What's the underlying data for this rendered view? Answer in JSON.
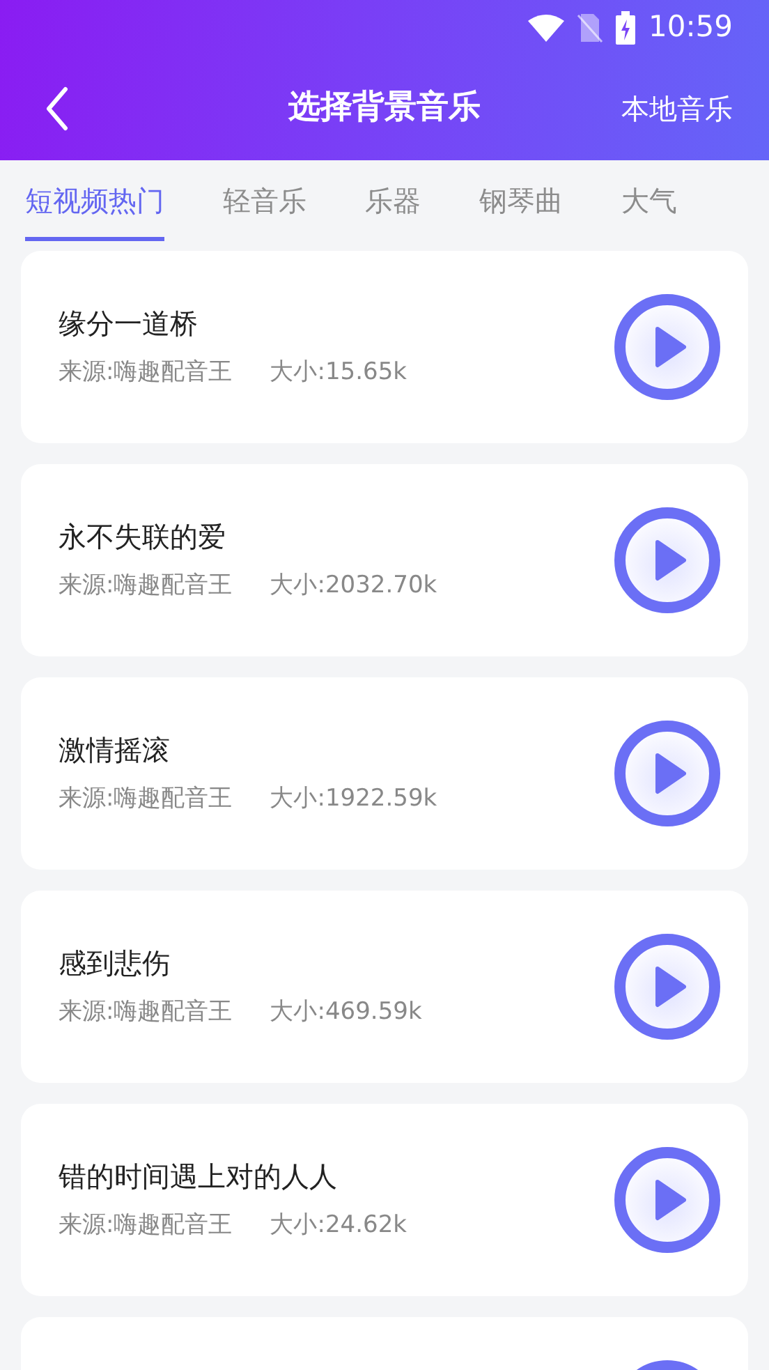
{
  "status_bar": {
    "time": "10:59"
  },
  "header": {
    "title": "选择背景音乐",
    "action": "本地音乐"
  },
  "tabs": [
    {
      "label": "短视频热门",
      "selected": true
    },
    {
      "label": "轻音乐",
      "selected": false
    },
    {
      "label": "乐器",
      "selected": false
    },
    {
      "label": "钢琴曲",
      "selected": false
    },
    {
      "label": "大气",
      "selected": false
    }
  ],
  "songs": [
    {
      "kind": "song",
      "title": "缘分一道桥",
      "source": "来源:嗨趣配音王",
      "size": "大小:15.65k"
    },
    {
      "kind": "song",
      "title": "永不失联的爱",
      "source": "来源:嗨趣配音王",
      "size": "大小:2032.70k"
    },
    {
      "kind": "song",
      "title": "激情摇滚",
      "source": "来源:嗨趣配音王",
      "size": "大小:1922.59k"
    },
    {
      "kind": "song",
      "title": "感到悲伤",
      "source": "来源:嗨趣配音王",
      "size": "大小:469.59k"
    },
    {
      "kind": "song",
      "title": "错的时间遇上对的人人",
      "source": "来源:嗨趣配音王",
      "size": "大小:24.62k"
    },
    {
      "kind": "cut"
    }
  ]
}
